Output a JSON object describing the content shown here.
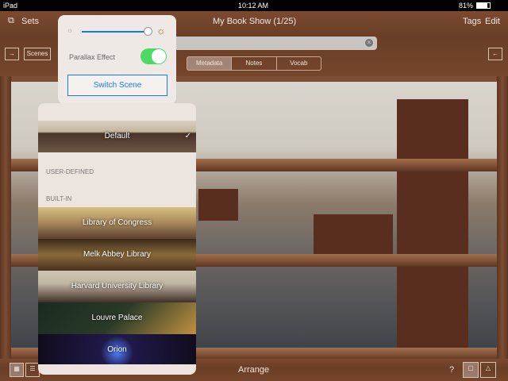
{
  "status": {
    "device": "iPad",
    "time": "10:12 AM",
    "battery": "81%"
  },
  "toolbar": {
    "sets": "Sets",
    "title": "My Book Show (1/25)",
    "tags": "Tags",
    "edit": "Edit",
    "scenes": "Scenes",
    "search_value": ""
  },
  "segments": [
    "Metadata",
    "Notes",
    "Vocab"
  ],
  "popover": {
    "brightness": 0.95,
    "parallax_label": "Parallax Effect",
    "parallax_on": true,
    "switch_scene": "Switch Scene"
  },
  "scenes": {
    "default": "Default",
    "user_defined": "USER-DEFINED",
    "built_in": "BUILT-IN",
    "items": [
      "Library of Congress",
      "Melk Abbey Library",
      "Harvard University Library",
      "Louvre Palace",
      "Orion"
    ]
  },
  "bottom": {
    "arrange": "Arrange",
    "help": "?"
  },
  "colors": {
    "accent": "#1a7ae6",
    "toggle": "#4cd964"
  }
}
